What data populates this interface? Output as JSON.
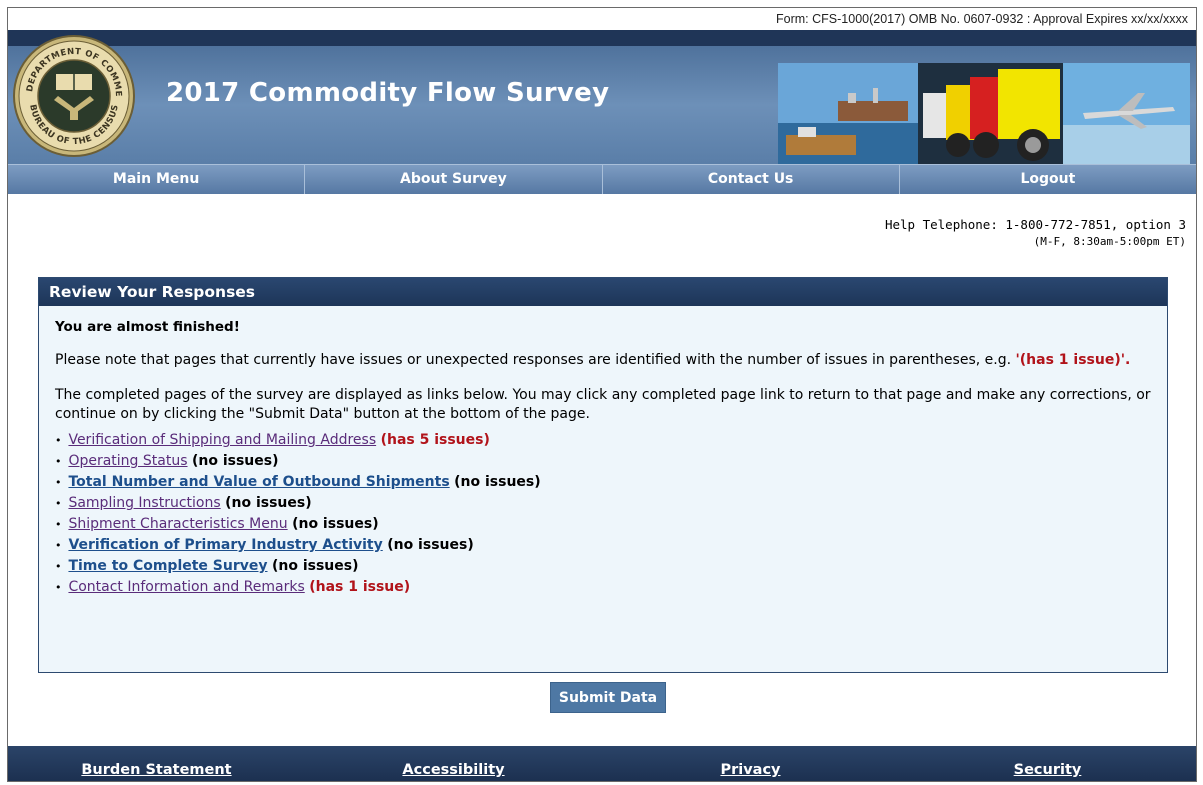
{
  "form_line": "Form: CFS-1000(2017) OMB No. 0607-0932 : Approval Expires xx/xx/xxxx",
  "header": {
    "title": "2017 Commodity Flow Survey",
    "seal": {
      "top_text": "U.S. DEPARTMENT OF COMMERCE",
      "bottom_text": "BUREAU OF THE CENSUS"
    }
  },
  "nav": {
    "items": [
      {
        "label": "Main Menu"
      },
      {
        "label": "About Survey"
      },
      {
        "label": "Contact Us"
      },
      {
        "label": "Logout"
      }
    ]
  },
  "help": {
    "phone": "Help Telephone: 1-800-772-7851, option 3",
    "hours": "(M-F, 8:30am-5:00pm ET)"
  },
  "review": {
    "heading": "Review Your Responses",
    "almost": "You are almost finished!",
    "note": "Please note that pages that currently have issues or unexpected responses are identified with the number of issues in parentheses, e.g.",
    "note_example": "'(has 1 issue)'.",
    "completed": "The completed pages of the survey are displayed as links below. You may click any completed page link to return to that page and make any corrections, or continue on by clicking the \"Submit Data\" button at the bottom of the page.",
    "links": [
      {
        "label": "Verification of Shipping and Mailing Address",
        "status": "(has 5 issues)"
      },
      {
        "label": "Operating Status",
        "status": "(no issues)"
      },
      {
        "label": "Total Number and Value of Outbound Shipments",
        "status": "(no issues)"
      },
      {
        "label": "Sampling Instructions",
        "status": "(no issues)"
      },
      {
        "label": "Shipment Characteristics Menu",
        "status": "(no issues)"
      },
      {
        "label": "Verification of Primary Industry Activity",
        "status": "(no issues)"
      },
      {
        "label": "Time to Complete Survey",
        "status": "(no issues)"
      },
      {
        "label": "Contact Information and Remarks",
        "status": "(has 1 issue)"
      }
    ]
  },
  "submit_label": "Submit Data",
  "footer": {
    "items": [
      {
        "label": "Burden Statement"
      },
      {
        "label": "Accessibility"
      },
      {
        "label": "Privacy"
      },
      {
        "label": "Security"
      }
    ]
  },
  "colors": {
    "issue": "#b1131a",
    "visited_link": "#5a2c7a",
    "link": "#1d4f8c",
    "header_dark": "#1f3557",
    "nav": "#6b8db4"
  }
}
